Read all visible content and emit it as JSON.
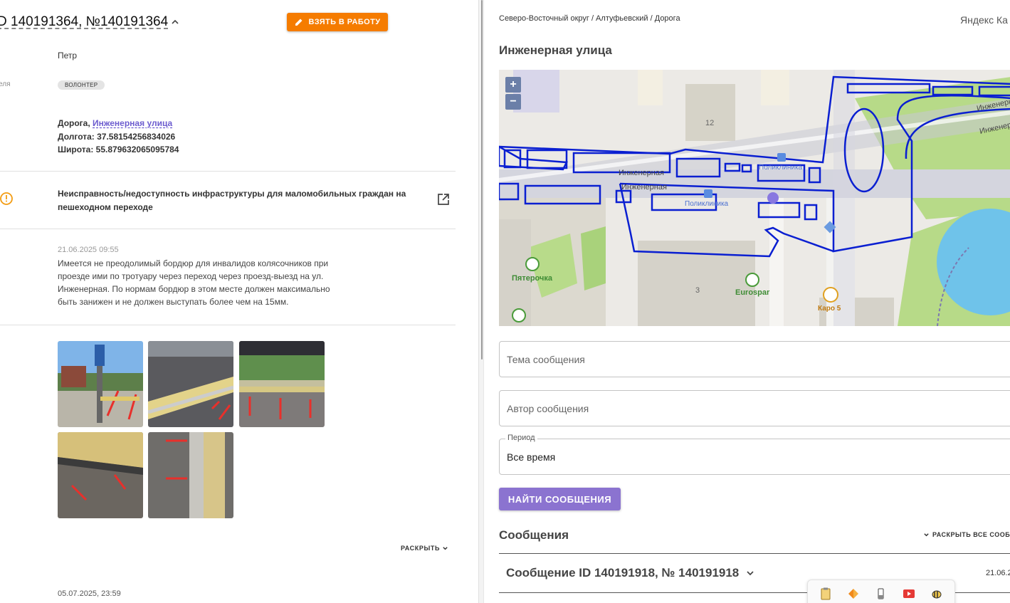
{
  "left": {
    "title": "D 140191364, №140191364",
    "take_button": "ВЗЯТЬ В РАБОТУ",
    "author_name": "Петр",
    "author_role_label": "еля",
    "author_chip": "ВОЛОНТЕР",
    "address": {
      "type": "Дорога",
      "street_link": "Инженерная улица",
      "longitude": "Долгота: 37.58154256834026",
      "latitude": "Широта: 55.879632065095784"
    },
    "issue": "Неисправность/недоступность инфраструктуры для маломобильных граждан на пешеходном переходе",
    "message_date": "21.06.2025 09:55",
    "description": "Имеется не преодолимый бордюр для инвалидов колясочников при проезде ими по тротуару через переход через проезд-выезд на ул. Инженерная. По нормам бордюр в этом месте должен максимально быть занижен и не должен выступать более чем на 15мм.",
    "expand_label": "РАСКРЫТЬ",
    "footer_date": "05.07.2025, 23:59"
  },
  "right": {
    "breadcrumb": "Северо-Восточный округ / Алтуфьевский / Дорога",
    "yandex_label": "Яндекс Ка",
    "street_title": "Инженерная улица",
    "map": {
      "zoom_in": "+",
      "zoom_out": "−",
      "labels": {
        "street1": "Инженерная",
        "street2": "Инженерная",
        "street3": "Инженерная",
        "street4": "Инженерная",
        "clinic1": "Поликлиника",
        "clinic2": "Поликлиника",
        "pyaterochka": "Пятерочка",
        "eurospar": "Eurospar",
        "karo": "Каро 5",
        "house12": "12",
        "house3": "3"
      }
    },
    "subject_placeholder": "Тема сообщения",
    "author_placeholder": "Автор сообщения",
    "period_legend": "Период",
    "period_value": "Все время",
    "find_button": "НАЙТИ СООБЩЕНИЯ",
    "messages_title": "Сообщения",
    "expand_all": "РАСКРЫТЬ ВСЕ СООБ",
    "message_item_title": "Сообщение ID 140191918, № 140191918",
    "message_item_date": "21.06.2"
  },
  "colors": {
    "accent_orange": "#f57c00",
    "accent_purple": "#8b73d0",
    "link_purple": "#6c5ccf",
    "map_outline": "#0a1fd1"
  },
  "taskbar_icons": [
    "clipboard-icon",
    "app-icon",
    "pen-icon",
    "screen-record-icon",
    "bee-icon"
  ]
}
